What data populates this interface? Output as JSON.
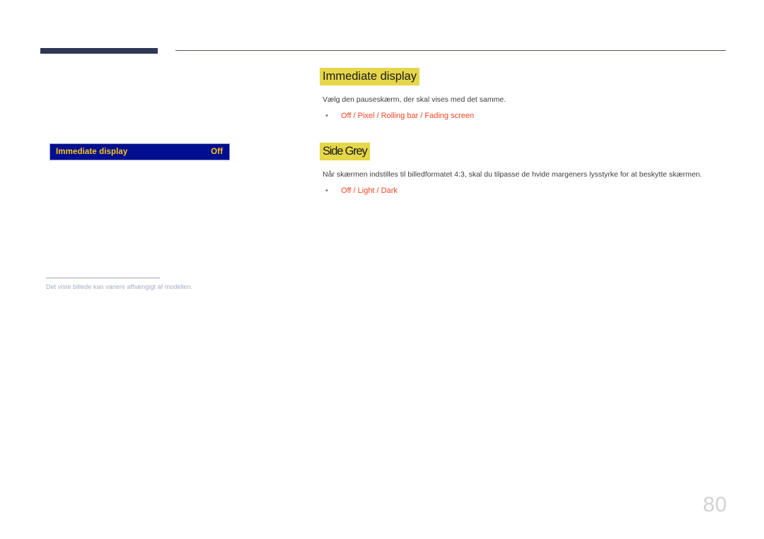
{
  "header": {
    "accent_bar_color": "#2e3754",
    "rule_color": "#4e5272"
  },
  "osd_preview": {
    "menu_label": "Immediate display",
    "menu_value": "Off",
    "bar_background": "#000f8f",
    "text_color": "#ffc41f",
    "caption": "Det viste billede kan variere afhængigt af modellen."
  },
  "sections": [
    {
      "heading": "Immediate display",
      "body": "Vælg den pauseskærm, der skal vises med det samme.",
      "options": "Off / Pixel / Rolling bar / Fading screen"
    },
    {
      "heading": "Side Grey",
      "body": "Når skærmen indstilles til billedformatet 4:3, skal du tilpasse de hvide margeners lysstyrke for at beskytte skærmen.",
      "options": "Off / Light / Dark"
    }
  ],
  "bullet_glyph": "•",
  "page_number": "80",
  "colors": {
    "highlight": "#e6d64a",
    "option_text": "#f04423",
    "body_text": "#3d3d3d",
    "page_number": "#d2d2d2"
  }
}
